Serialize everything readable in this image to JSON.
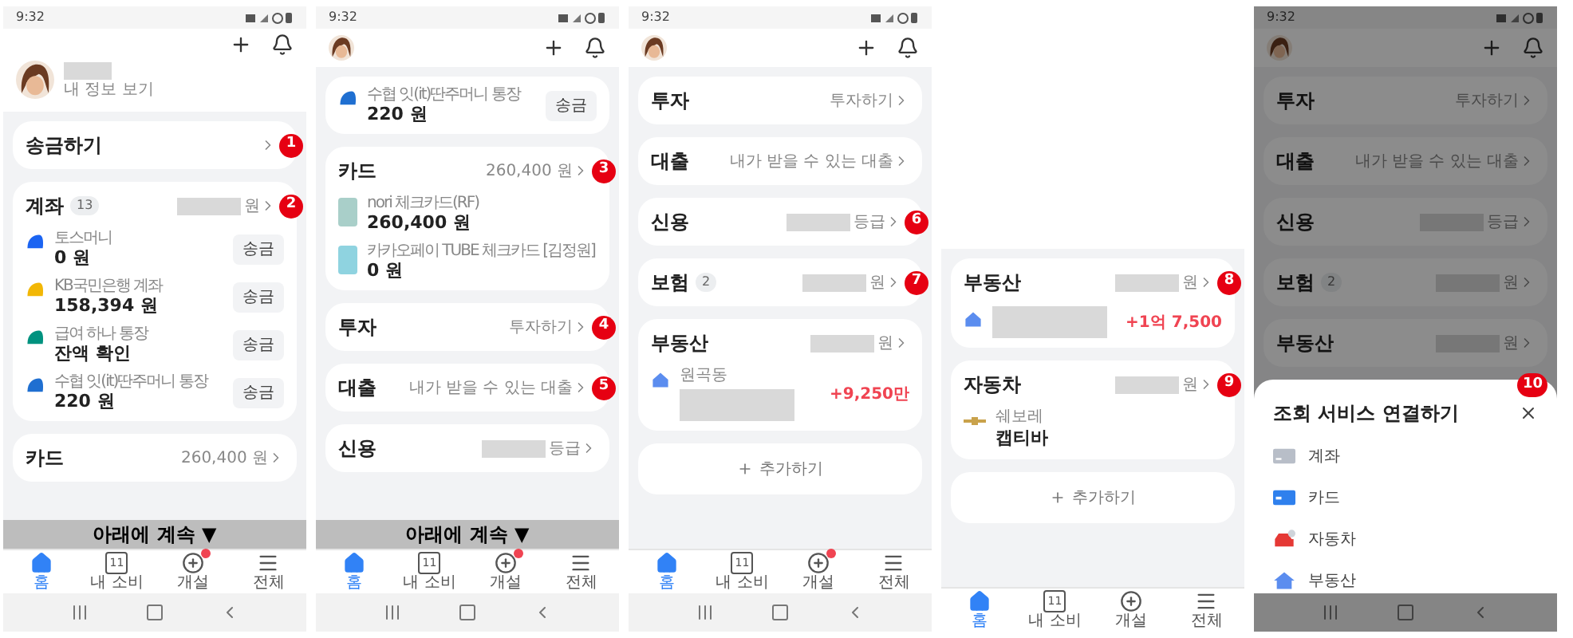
{
  "screens": [
    {
      "status_time": "9:32",
      "header": {
        "expanded": true,
        "name_redacted": true,
        "profile_link": "내 정보 보기"
      },
      "dimmed": false,
      "cards": [
        {
          "kind": "section",
          "title": "송금하기",
          "callout": "1"
        },
        {
          "kind": "section",
          "title": "계좌",
          "badge": "13",
          "redacted": true,
          "value": "원",
          "callout": "2",
          "items": [
            {
              "kind": "account",
              "color": "#1b64f2",
              "label": "토스머니",
              "amount": "0 원",
              "button": "송금"
            },
            {
              "kind": "account",
              "color": "#f2b705",
              "label": "KB국민은행 계좌",
              "amount": "158,394 원",
              "button": "송금"
            },
            {
              "kind": "account",
              "color": "#00927f",
              "label": "급여 하나 통장",
              "amount": "잔액 확인",
              "button": "송금"
            },
            {
              "kind": "account",
              "color": "#1f6fd1",
              "label": "수협 잇(it)딴주머니 통장",
              "amount": "220 원",
              "button": "송금"
            }
          ]
        },
        {
          "kind": "section",
          "title": "카드",
          "value": "260,400 원"
        }
      ],
      "continue_banner": "아래에 계속 ▼",
      "tabs": [
        {
          "kind": "home",
          "label": "홈",
          "selected": true,
          "dot": false
        },
        {
          "kind": "calendar",
          "date": "11",
          "label": "내 소비",
          "selected": false,
          "dot": false
        },
        {
          "kind": "add",
          "label": "개설",
          "selected": false,
          "dot": true
        },
        {
          "kind": "menu",
          "label": "전체",
          "selected": false,
          "dot": false
        }
      ],
      "system_nav": true
    },
    {
      "status_time": "9:32",
      "header": {
        "expanded": false
      },
      "dimmed": false,
      "cards": [
        {
          "kind": "continued",
          "items": [
            {
              "kind": "account",
              "color": "#1f6fd1",
              "label": "수협 잇(it)딴주머니 통장",
              "amount": "220 원",
              "button": "송금"
            }
          ]
        },
        {
          "kind": "section",
          "title": "카드",
          "value": "260,400 원",
          "callout": "3",
          "items": [
            {
              "kind": "card",
              "color": "#a9cfc9",
              "label": "nori 체크카드(RF)",
              "amount": "260,400 원"
            },
            {
              "kind": "card",
              "color": "#8fd3e0",
              "label": "카카오페이 TUBE 체크카드 [김정원]",
              "amount": "0 원"
            }
          ]
        },
        {
          "kind": "section",
          "title": "투자",
          "value": "투자하기",
          "callout": "4"
        },
        {
          "kind": "section",
          "title": "대출",
          "value": "내가 받을 수 있는 대출",
          "callout": "5"
        },
        {
          "kind": "section",
          "title": "신용",
          "redacted": true,
          "value": "등급"
        }
      ],
      "continue_banner": "아래에 계속 ▼",
      "tabs": [
        {
          "kind": "home",
          "label": "홈",
          "selected": true,
          "dot": false
        },
        {
          "kind": "calendar",
          "date": "11",
          "label": "내 소비",
          "selected": false,
          "dot": false
        },
        {
          "kind": "add",
          "label": "개설",
          "selected": false,
          "dot": true
        },
        {
          "kind": "menu",
          "label": "전체",
          "selected": false,
          "dot": false
        }
      ],
      "system_nav": true
    },
    {
      "status_time": "9:32",
      "header": {
        "expanded": false
      },
      "dimmed": false,
      "cards": [
        {
          "kind": "section",
          "title": "투자",
          "value": "투자하기"
        },
        {
          "kind": "section",
          "title": "대출",
          "value": "내가 받을 수 있는 대출"
        },
        {
          "kind": "section",
          "title": "신용",
          "redacted": true,
          "value": "등급",
          "callout": "6"
        },
        {
          "kind": "section",
          "title": "보험",
          "badge": "2",
          "redacted": true,
          "value": "원",
          "callout": "7"
        },
        {
          "kind": "section",
          "title": "부동산",
          "redacted": true,
          "value": "원",
          "items": [
            {
              "kind": "property",
              "label": "원곡동",
              "redacted": true,
              "change": "+9,250만"
            }
          ]
        },
        {
          "kind": "add",
          "label": "추가하기"
        }
      ],
      "tabs": [
        {
          "kind": "home",
          "label": "홈",
          "selected": true,
          "dot": false
        },
        {
          "kind": "calendar",
          "date": "11",
          "label": "내 소비",
          "selected": false,
          "dot": false
        },
        {
          "kind": "add",
          "label": "개설",
          "selected": false,
          "dot": true
        },
        {
          "kind": "menu",
          "label": "전체",
          "selected": false,
          "dot": false
        }
      ],
      "system_nav": true
    },
    {
      "dimmed": false,
      "cards": [
        {
          "kind": "section",
          "title": "부동산",
          "redacted": true,
          "value": "원",
          "callout": "8",
          "items": [
            {
              "kind": "property",
              "redacted": true,
              "change": "+1억 7,500"
            }
          ]
        },
        {
          "kind": "section",
          "title": "자동차",
          "redacted": true,
          "value": "원",
          "callout": "9",
          "items": [
            {
              "kind": "car",
              "label": "쉐보레",
              "model": "캡티바"
            }
          ]
        },
        {
          "kind": "add",
          "label": "추가하기"
        }
      ],
      "tabs": [
        {
          "kind": "home",
          "label": "홈",
          "selected": true,
          "dot": false
        },
        {
          "kind": "calendar",
          "date": "11",
          "label": "내 소비",
          "selected": false,
          "dot": false
        },
        {
          "kind": "add",
          "label": "개설",
          "selected": false,
          "dot": false
        },
        {
          "kind": "menu",
          "label": "전체",
          "selected": false,
          "dot": false
        }
      ],
      "system_nav": false
    },
    {
      "status_time": "9:32",
      "header": {
        "expanded": false
      },
      "dimmed": true,
      "cards": [
        {
          "kind": "section",
          "title": "투자",
          "value": "투자하기"
        },
        {
          "kind": "section",
          "title": "대출",
          "value": "내가 받을 수 있는 대출"
        },
        {
          "kind": "section",
          "title": "신용",
          "redacted": true,
          "value": "등급"
        },
        {
          "kind": "section",
          "title": "보험",
          "badge": "2",
          "redacted": true,
          "value": "원"
        },
        {
          "kind": "section",
          "title": "부동산",
          "redacted": true,
          "value": "원"
        }
      ],
      "sheet": {
        "title": "조회 서비스 연결하기",
        "callout": "10",
        "options": [
          {
            "kind": "account",
            "label": "계좌"
          },
          {
            "kind": "card",
            "label": "카드"
          },
          {
            "kind": "car",
            "label": "자동차"
          },
          {
            "kind": "property",
            "label": "부동산"
          }
        ]
      },
      "system_nav": true
    }
  ]
}
